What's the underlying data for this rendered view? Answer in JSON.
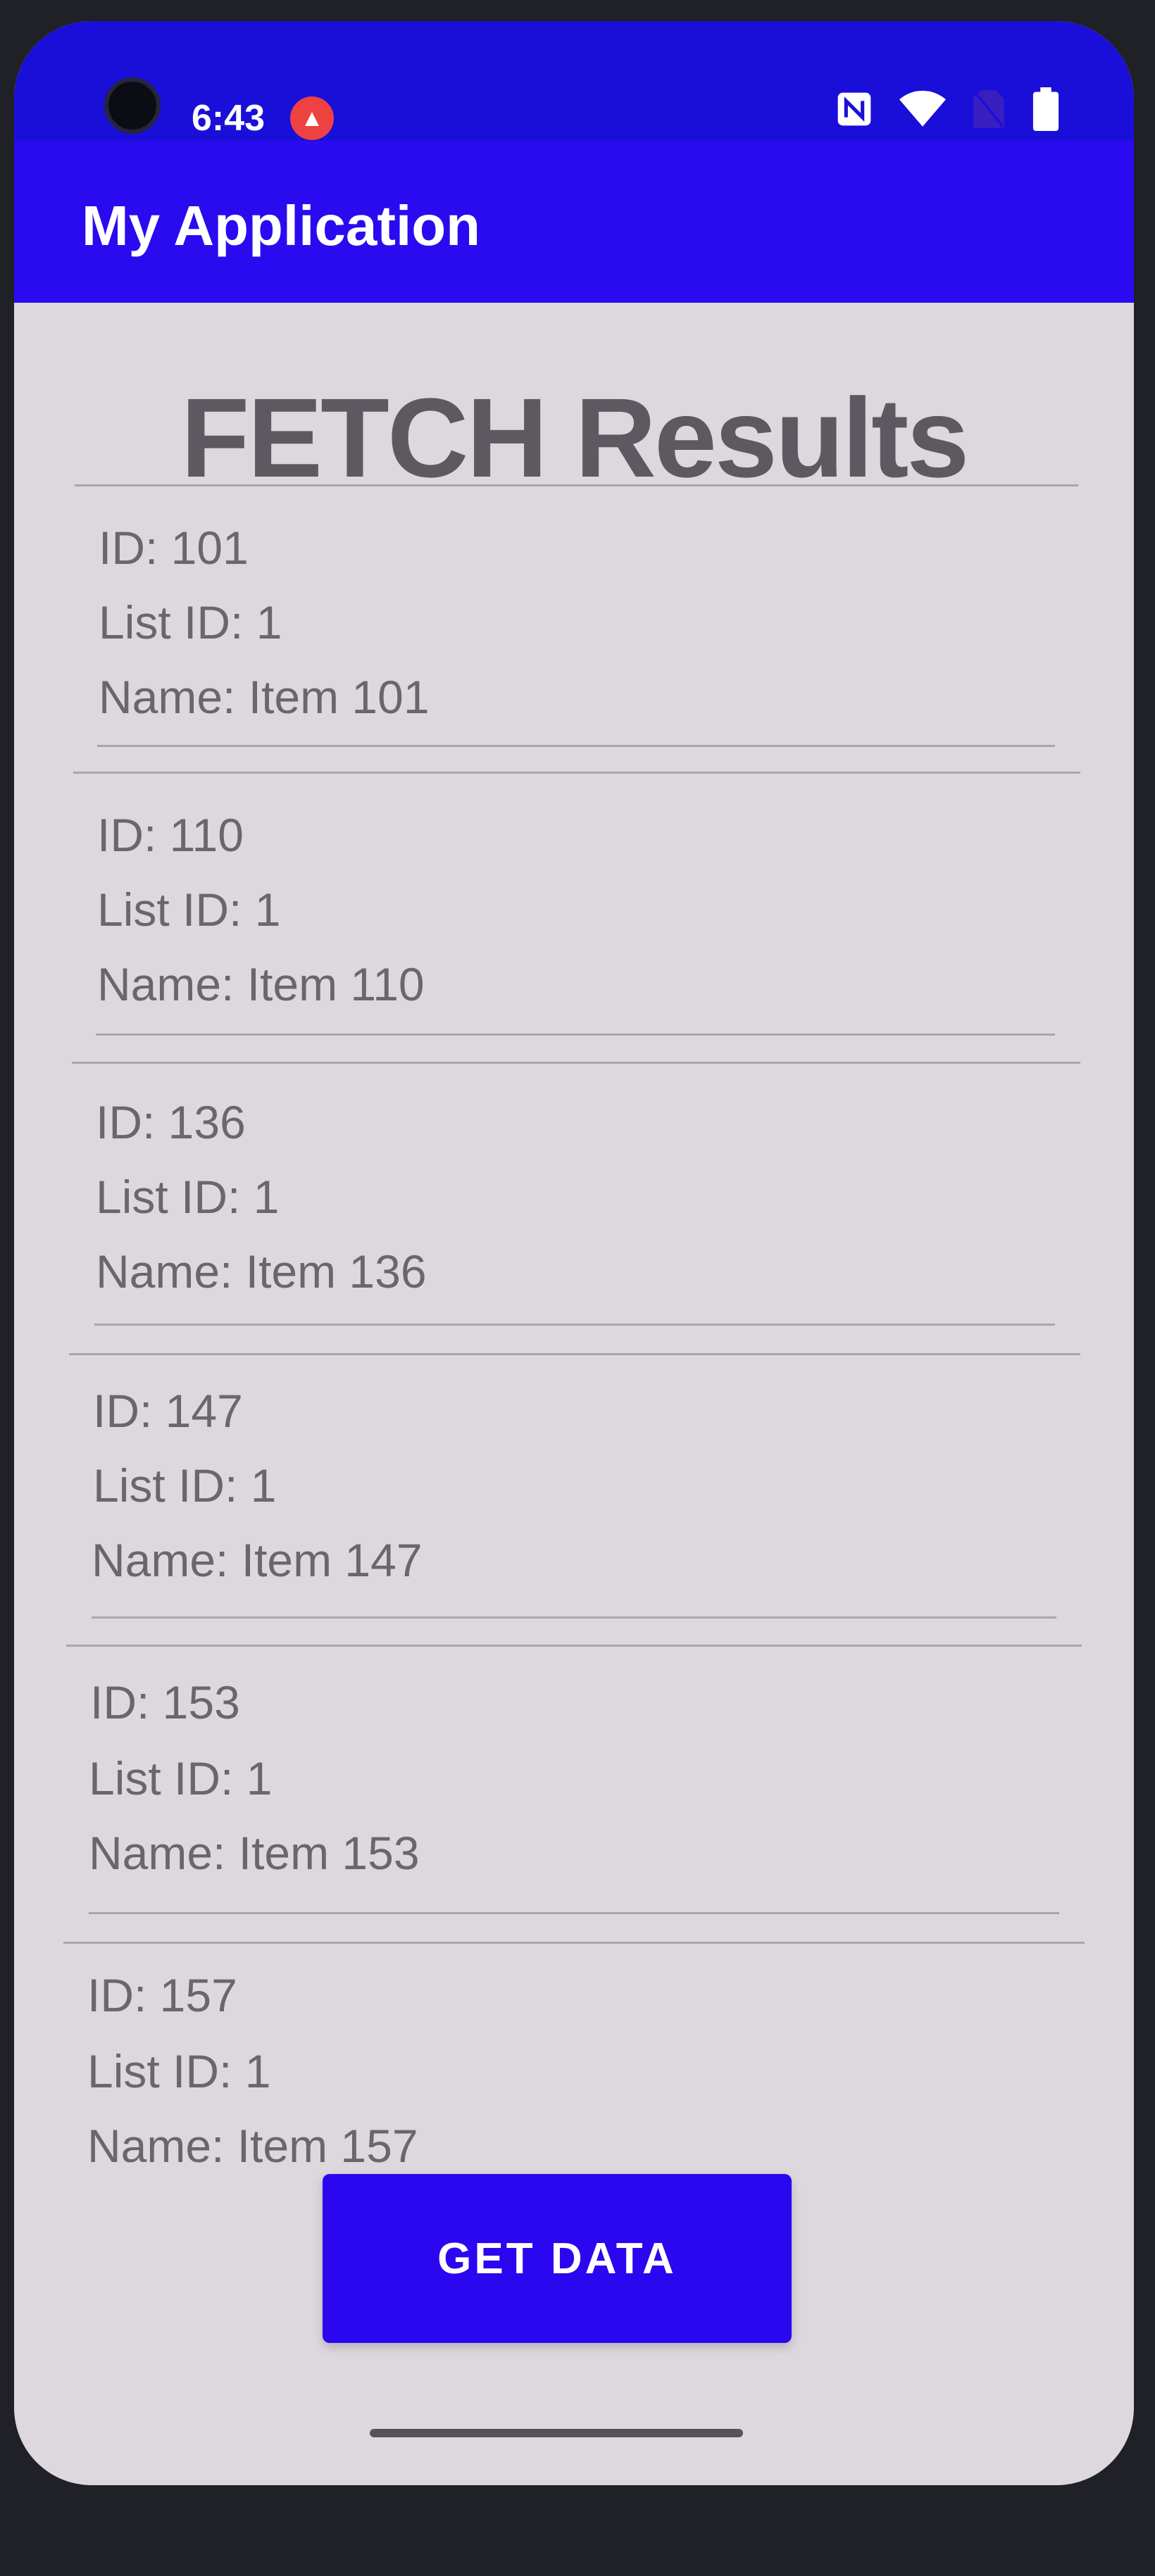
{
  "status_bar": {
    "time": "6:43",
    "notification_icon": "account-alert-icon",
    "icons": [
      "nfc-icon",
      "wifi-icon",
      "sim-off-icon",
      "battery-icon"
    ]
  },
  "app_bar": {
    "title": "My Application"
  },
  "main": {
    "heading": "FETCH Results",
    "items": [
      {
        "id": "ID: 101",
        "list_id": "List ID: 1",
        "name": "Name: Item 101"
      },
      {
        "id": "ID: 110",
        "list_id": "List ID: 1",
        "name": "Name: Item 110"
      },
      {
        "id": "ID: 136",
        "list_id": "List ID: 1",
        "name": "Name: Item 136"
      },
      {
        "id": "ID: 147",
        "list_id": "List ID: 1",
        "name": "Name: Item 147"
      },
      {
        "id": "ID: 153",
        "list_id": "List ID: 1",
        "name": "Name: Item 153"
      },
      {
        "id": "ID: 157",
        "list_id": "List ID: 1",
        "name": "Name: Item 157"
      }
    ]
  },
  "actions": {
    "get_data_label": "GET DATA"
  },
  "colors": {
    "primary": "#2a0bf0",
    "status_bar": "#1a0fd8",
    "background": "#ddd8de",
    "text": "#6a676c"
  }
}
